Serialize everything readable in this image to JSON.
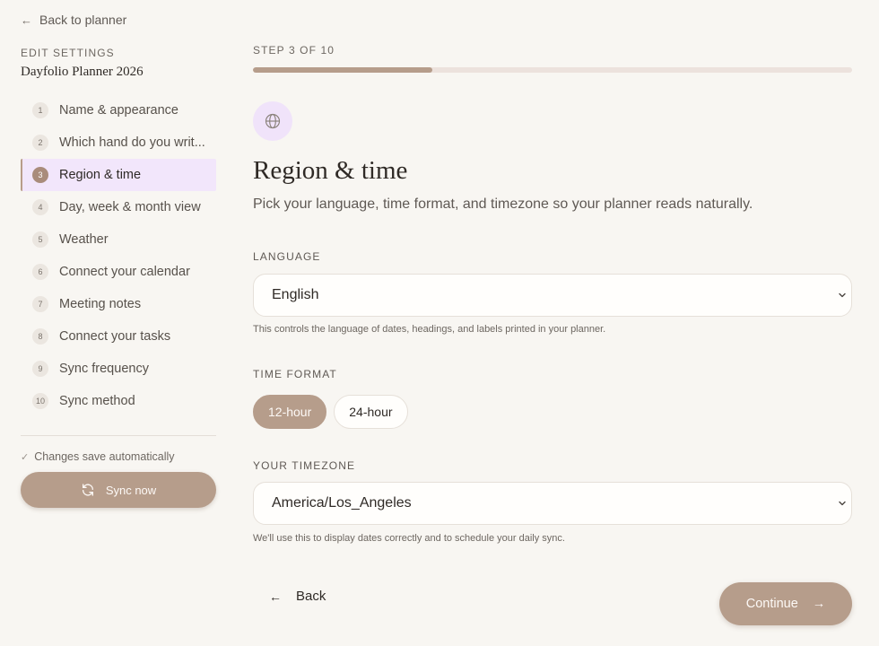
{
  "sidebar": {
    "back_label": "Back to planner",
    "eyebrow": "EDIT SETTINGS",
    "planner_name": "Dayfolio Planner 2026",
    "steps": [
      {
        "num": "1",
        "label": "Name & appearance"
      },
      {
        "num": "2",
        "label": "Which hand do you writ..."
      },
      {
        "num": "3",
        "label": "Region & time"
      },
      {
        "num": "4",
        "label": "Day, week & month view"
      },
      {
        "num": "5",
        "label": "Weather"
      },
      {
        "num": "6",
        "label": "Connect your calendar"
      },
      {
        "num": "7",
        "label": "Meeting notes"
      },
      {
        "num": "8",
        "label": "Connect your tasks"
      },
      {
        "num": "9",
        "label": "Sync frequency"
      },
      {
        "num": "10",
        "label": "Sync method"
      }
    ],
    "active_step": 3,
    "autosave_text": "Changes save automatically",
    "sync_label": "Sync now"
  },
  "main": {
    "step_label": "STEP 3 OF 10",
    "progress_fraction": 0.3,
    "title": "Region & time",
    "subtitle": "Pick your language, time format, and timezone so your planner reads naturally.",
    "language": {
      "label": "LANGUAGE",
      "value": "English",
      "help": "This controls the language of dates, headings, and labels printed in your planner."
    },
    "time_format": {
      "label": "TIME FORMAT",
      "options": [
        "12-hour",
        "24-hour"
      ],
      "selected": "12-hour"
    },
    "timezone": {
      "label": "YOUR TIMEZONE",
      "value": "America/Los_Angeles",
      "help": "We'll use this to display dates correctly and to schedule your daily sync."
    },
    "back_label": "Back",
    "continue_label": "Continue"
  },
  "colors": {
    "accent": "#b69d8b",
    "active_bg": "#f2e6fb",
    "page_bg": "#f8f6f2"
  },
  "icons": {
    "back": "arrow-left-icon",
    "check": "check-icon",
    "sync": "refresh-icon",
    "section": "globe-icon",
    "select": "chevron-down-icon",
    "continue": "arrow-right-icon"
  }
}
